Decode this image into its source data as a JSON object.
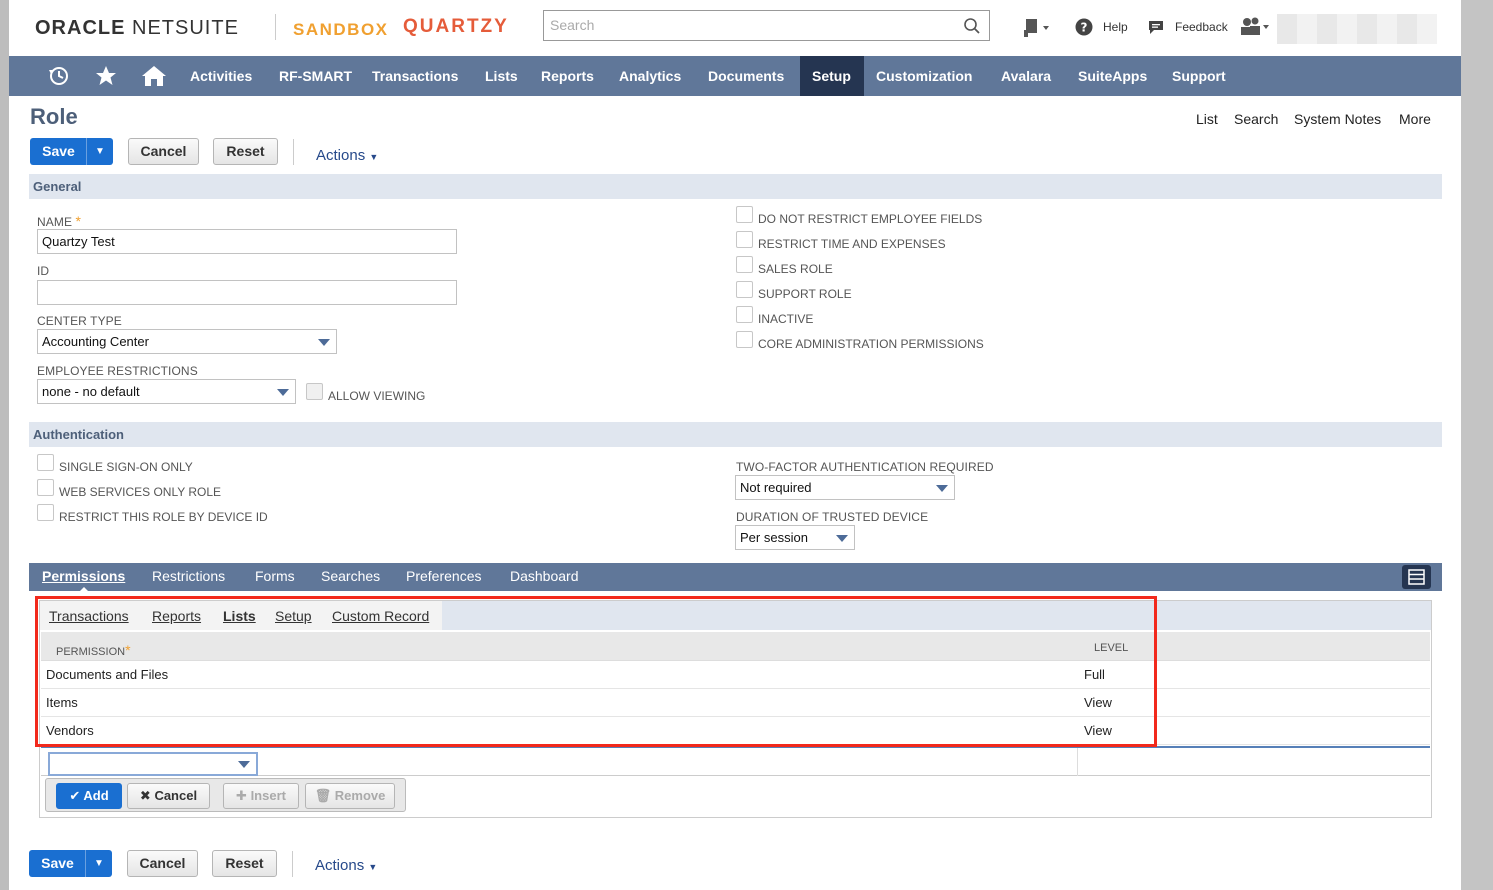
{
  "header": {
    "brand_oracle": "ORACLE",
    "brand_netsuite": "NETSUITE",
    "brand_sandbox": "SANDBOX",
    "brand_quartzy": "QUARTZY",
    "search_placeholder": "Search",
    "help": "Help",
    "feedback": "Feedback"
  },
  "nav": {
    "items": [
      "Activities",
      "RF-SMART",
      "Transactions",
      "Lists",
      "Reports",
      "Analytics",
      "Documents",
      "Setup",
      "Customization",
      "Avalara",
      "SuiteApps",
      "Support"
    ],
    "active": "Setup"
  },
  "page": {
    "title": "Role",
    "links": [
      "List",
      "Search",
      "System Notes",
      "More"
    ]
  },
  "buttons": {
    "save": "Save",
    "cancel": "Cancel",
    "reset": "Reset",
    "actions": "Actions"
  },
  "general": {
    "header": "General",
    "name_label": "NAME",
    "name_value": "Quartzy Test",
    "id_label": "ID",
    "id_value": "",
    "center_type_label": "CENTER TYPE",
    "center_type_value": "Accounting Center",
    "employee_restrictions_label": "EMPLOYEE RESTRICTIONS",
    "employee_restrictions_value": "none - no default",
    "allow_viewing": "ALLOW VIEWING",
    "checkboxes": [
      "DO NOT RESTRICT EMPLOYEE FIELDS",
      "RESTRICT TIME AND EXPENSES",
      "SALES ROLE",
      "SUPPORT ROLE",
      "INACTIVE",
      "CORE ADMINISTRATION PERMISSIONS"
    ]
  },
  "authentication": {
    "header": "Authentication",
    "checkboxes": [
      "SINGLE SIGN-ON ONLY",
      "WEB SERVICES ONLY ROLE",
      "RESTRICT THIS ROLE BY DEVICE ID"
    ],
    "two_factor_label": "TWO-FACTOR AUTHENTICATION REQUIRED",
    "two_factor_value": "Not required",
    "duration_label": "DURATION OF TRUSTED DEVICE",
    "duration_value": "Per session"
  },
  "tabs": {
    "main": [
      "Permissions",
      "Restrictions",
      "Forms",
      "Searches",
      "Preferences",
      "Dashboard"
    ],
    "main_active": "Permissions",
    "sub": [
      "Transactions",
      "Reports",
      "Lists",
      "Setup",
      "Custom Record"
    ],
    "sub_active": "Lists"
  },
  "permissions_table": {
    "col_permission": "PERMISSION",
    "col_level": "LEVEL",
    "rows": [
      {
        "permission": "Documents and Files",
        "level": "Full"
      },
      {
        "permission": "Items",
        "level": "View"
      },
      {
        "permission": "Vendors",
        "level": "View"
      }
    ]
  },
  "row_buttons": {
    "add": "Add",
    "cancel": "Cancel",
    "insert": "Insert",
    "remove": "Remove"
  },
  "colors": {
    "nav_bg": "#607799",
    "nav_active": "#253551",
    "save_blue": "#1a6fd1",
    "highlight_red": "#f2291c"
  }
}
